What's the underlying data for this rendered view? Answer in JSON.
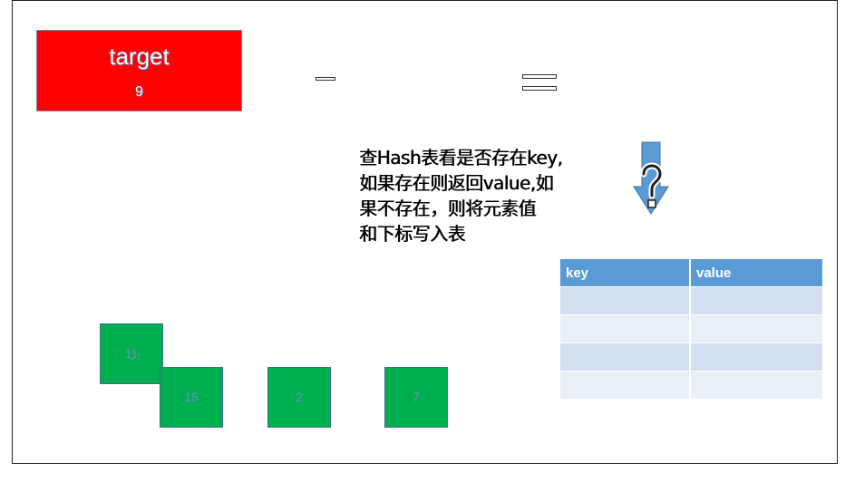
{
  "target": {
    "label": "target",
    "value": "9"
  },
  "description": {
    "lines": [
      "查Hash表看是否存在key,",
      "如果存在则返回value,如",
      "果不存在，则将元素值",
      "和下标写入表"
    ]
  },
  "table": {
    "headers": [
      "key",
      "value"
    ],
    "rows": [
      [
        "",
        ""
      ],
      [
        "",
        ""
      ],
      [
        "",
        ""
      ],
      [
        "",
        ""
      ]
    ]
  },
  "numbers": [
    "11",
    "15",
    "2",
    "7"
  ],
  "colors": {
    "target_bg": "#ff0000",
    "number_bg": "#00b050",
    "table_header": "#5b9bd5",
    "table_row_odd": "#d2dff0",
    "table_row_even": "#e9eff7",
    "arrow": "#5b9bd5"
  },
  "icons": {
    "arrow": "down-arrow-with-question-mark-icon"
  }
}
